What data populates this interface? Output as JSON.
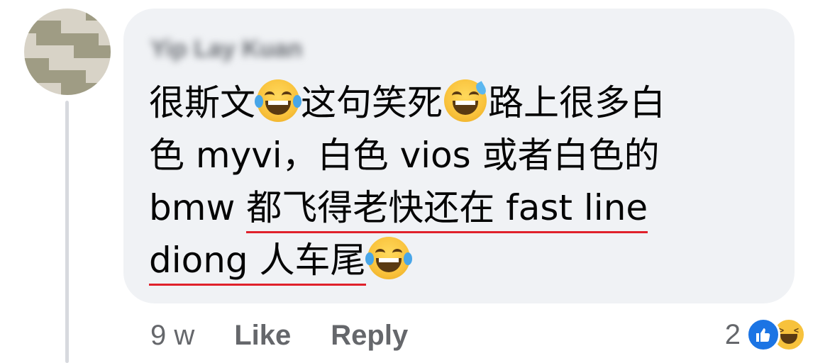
{
  "comment": {
    "author": "Yip Lay Kuan",
    "text_segments": [
      {
        "text": "很斯文",
        "underline": false
      },
      {
        "emoji": "laughing-tears"
      },
      {
        "text": "这句笑死",
        "underline": false
      },
      {
        "emoji": "sweat-smile"
      },
      {
        "text": "路上很多白",
        "underline": false
      },
      {
        "break": true
      },
      {
        "text": "色 myvi，白色 vios 或者白色的",
        "underline": false
      },
      {
        "break": true
      },
      {
        "text": "bmw ",
        "underline": false
      },
      {
        "text": "都飞得老快还在 fast line",
        "underline": true
      },
      {
        "break": true
      },
      {
        "text": "diong 人车尾",
        "underline": true
      },
      {
        "emoji": "laughing-tears"
      }
    ]
  },
  "meta": {
    "time": "9 w",
    "like_label": "Like",
    "reply_label": "Reply"
  },
  "reactions": {
    "count": "2",
    "types": [
      "like",
      "haha"
    ]
  },
  "colors": {
    "bubble": "#f0f2f5",
    "text": "#050505",
    "meta": "#65676b",
    "underline": "#e0212b",
    "like": "#1b74e4"
  }
}
